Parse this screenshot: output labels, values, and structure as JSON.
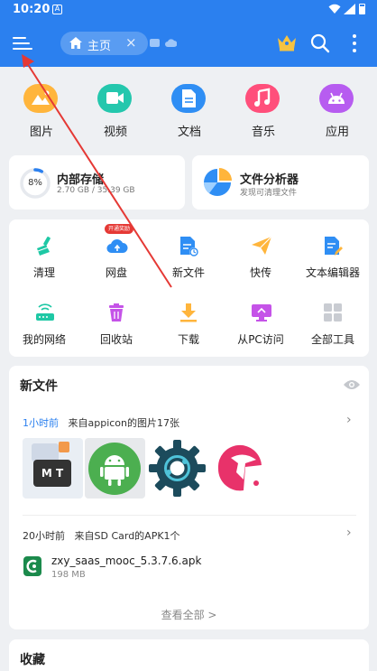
{
  "status": {
    "time": "10:20",
    "notif_glyph": "A"
  },
  "header": {
    "tab_label": "主页",
    "tab_close": "×",
    "icons": [
      "menu-icon",
      "home-icon",
      "crown-icon",
      "search-icon",
      "more-icon"
    ]
  },
  "categories": [
    {
      "label": "图片",
      "icon": "image-icon",
      "color": "#ffb53c"
    },
    {
      "label": "视频",
      "icon": "video-icon",
      "color": "#24c7ad"
    },
    {
      "label": "文档",
      "icon": "document-icon",
      "color": "#2f8ef4"
    },
    {
      "label": "音乐",
      "icon": "music-icon",
      "color": "#ff4f7b"
    },
    {
      "label": "应用",
      "icon": "android-icon",
      "color": "#b75cf0"
    }
  ],
  "storage": {
    "title": "内部存储",
    "sub": "2.70 GB / 35.39 GB",
    "percent_label": "8%",
    "percent": 0.08
  },
  "analyzer": {
    "title": "文件分析器",
    "sub": "发现可清理文件"
  },
  "tools": [
    {
      "label": "清理",
      "icon": "broom-icon"
    },
    {
      "label": "网盘",
      "icon": "cloud-icon",
      "badge": "开通奖励"
    },
    {
      "label": "新文件",
      "icon": "new-file-icon"
    },
    {
      "label": "快传",
      "icon": "send-icon"
    },
    {
      "label": "文本编辑器",
      "icon": "text-editor-icon"
    },
    {
      "label": "我的网络",
      "icon": "router-icon"
    },
    {
      "label": "回收站",
      "icon": "recycle-bin-icon"
    },
    {
      "label": "下载",
      "icon": "download-icon"
    },
    {
      "label": "从PC访问",
      "icon": "pc-access-icon"
    },
    {
      "label": "全部工具",
      "icon": "all-tools-icon"
    }
  ],
  "recent": {
    "title": "新文件",
    "group1": {
      "when": "1小时前",
      "desc": "来自appicon的图片17张"
    },
    "group2": {
      "when": "20小时前",
      "desc": "来自SD Card的APK1个"
    },
    "apk": {
      "name": "zxy_saas_mooc_5.3.7.6.apk",
      "size": "198 MB"
    },
    "view_all": "查看全部 >",
    "chevron": "›",
    "thumb_text": "M T"
  },
  "favorites": {
    "title": "收藏"
  },
  "colors": {
    "accent": "#2b80ef",
    "annotation": "#e53935"
  }
}
